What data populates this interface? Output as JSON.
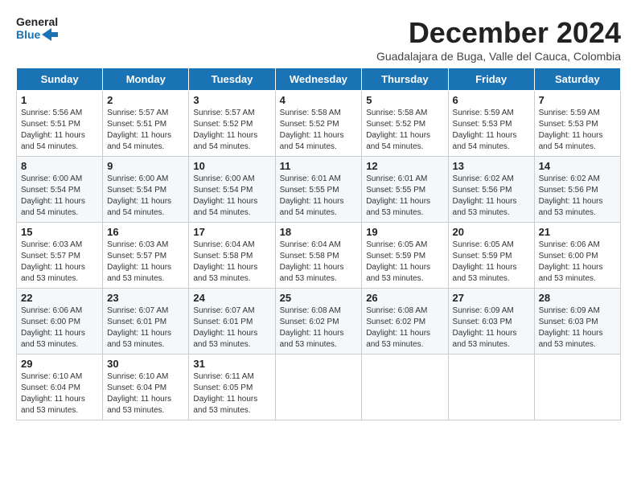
{
  "header": {
    "logo_line1": "General",
    "logo_line2": "Blue",
    "month_title": "December 2024",
    "subtitle": "Guadalajara de Buga, Valle del Cauca, Colombia"
  },
  "weekdays": [
    "Sunday",
    "Monday",
    "Tuesday",
    "Wednesday",
    "Thursday",
    "Friday",
    "Saturday"
  ],
  "weeks": [
    [
      {
        "day": "1",
        "sunrise": "5:56 AM",
        "sunset": "5:51 PM",
        "daylight": "11 hours and 54 minutes."
      },
      {
        "day": "2",
        "sunrise": "5:57 AM",
        "sunset": "5:51 PM",
        "daylight": "11 hours and 54 minutes."
      },
      {
        "day": "3",
        "sunrise": "5:57 AM",
        "sunset": "5:52 PM",
        "daylight": "11 hours and 54 minutes."
      },
      {
        "day": "4",
        "sunrise": "5:58 AM",
        "sunset": "5:52 PM",
        "daylight": "11 hours and 54 minutes."
      },
      {
        "day": "5",
        "sunrise": "5:58 AM",
        "sunset": "5:52 PM",
        "daylight": "11 hours and 54 minutes."
      },
      {
        "day": "6",
        "sunrise": "5:59 AM",
        "sunset": "5:53 PM",
        "daylight": "11 hours and 54 minutes."
      },
      {
        "day": "7",
        "sunrise": "5:59 AM",
        "sunset": "5:53 PM",
        "daylight": "11 hours and 54 minutes."
      }
    ],
    [
      {
        "day": "8",
        "sunrise": "6:00 AM",
        "sunset": "5:54 PM",
        "daylight": "11 hours and 54 minutes."
      },
      {
        "day": "9",
        "sunrise": "6:00 AM",
        "sunset": "5:54 PM",
        "daylight": "11 hours and 54 minutes."
      },
      {
        "day": "10",
        "sunrise": "6:00 AM",
        "sunset": "5:54 PM",
        "daylight": "11 hours and 54 minutes."
      },
      {
        "day": "11",
        "sunrise": "6:01 AM",
        "sunset": "5:55 PM",
        "daylight": "11 hours and 54 minutes."
      },
      {
        "day": "12",
        "sunrise": "6:01 AM",
        "sunset": "5:55 PM",
        "daylight": "11 hours and 53 minutes."
      },
      {
        "day": "13",
        "sunrise": "6:02 AM",
        "sunset": "5:56 PM",
        "daylight": "11 hours and 53 minutes."
      },
      {
        "day": "14",
        "sunrise": "6:02 AM",
        "sunset": "5:56 PM",
        "daylight": "11 hours and 53 minutes."
      }
    ],
    [
      {
        "day": "15",
        "sunrise": "6:03 AM",
        "sunset": "5:57 PM",
        "daylight": "11 hours and 53 minutes."
      },
      {
        "day": "16",
        "sunrise": "6:03 AM",
        "sunset": "5:57 PM",
        "daylight": "11 hours and 53 minutes."
      },
      {
        "day": "17",
        "sunrise": "6:04 AM",
        "sunset": "5:58 PM",
        "daylight": "11 hours and 53 minutes."
      },
      {
        "day": "18",
        "sunrise": "6:04 AM",
        "sunset": "5:58 PM",
        "daylight": "11 hours and 53 minutes."
      },
      {
        "day": "19",
        "sunrise": "6:05 AM",
        "sunset": "5:59 PM",
        "daylight": "11 hours and 53 minutes."
      },
      {
        "day": "20",
        "sunrise": "6:05 AM",
        "sunset": "5:59 PM",
        "daylight": "11 hours and 53 minutes."
      },
      {
        "day": "21",
        "sunrise": "6:06 AM",
        "sunset": "6:00 PM",
        "daylight": "11 hours and 53 minutes."
      }
    ],
    [
      {
        "day": "22",
        "sunrise": "6:06 AM",
        "sunset": "6:00 PM",
        "daylight": "11 hours and 53 minutes."
      },
      {
        "day": "23",
        "sunrise": "6:07 AM",
        "sunset": "6:01 PM",
        "daylight": "11 hours and 53 minutes."
      },
      {
        "day": "24",
        "sunrise": "6:07 AM",
        "sunset": "6:01 PM",
        "daylight": "11 hours and 53 minutes."
      },
      {
        "day": "25",
        "sunrise": "6:08 AM",
        "sunset": "6:02 PM",
        "daylight": "11 hours and 53 minutes."
      },
      {
        "day": "26",
        "sunrise": "6:08 AM",
        "sunset": "6:02 PM",
        "daylight": "11 hours and 53 minutes."
      },
      {
        "day": "27",
        "sunrise": "6:09 AM",
        "sunset": "6:03 PM",
        "daylight": "11 hours and 53 minutes."
      },
      {
        "day": "28",
        "sunrise": "6:09 AM",
        "sunset": "6:03 PM",
        "daylight": "11 hours and 53 minutes."
      }
    ],
    [
      {
        "day": "29",
        "sunrise": "6:10 AM",
        "sunset": "6:04 PM",
        "daylight": "11 hours and 53 minutes."
      },
      {
        "day": "30",
        "sunrise": "6:10 AM",
        "sunset": "6:04 PM",
        "daylight": "11 hours and 53 minutes."
      },
      {
        "day": "31",
        "sunrise": "6:11 AM",
        "sunset": "6:05 PM",
        "daylight": "11 hours and 53 minutes."
      },
      null,
      null,
      null,
      null
    ]
  ]
}
